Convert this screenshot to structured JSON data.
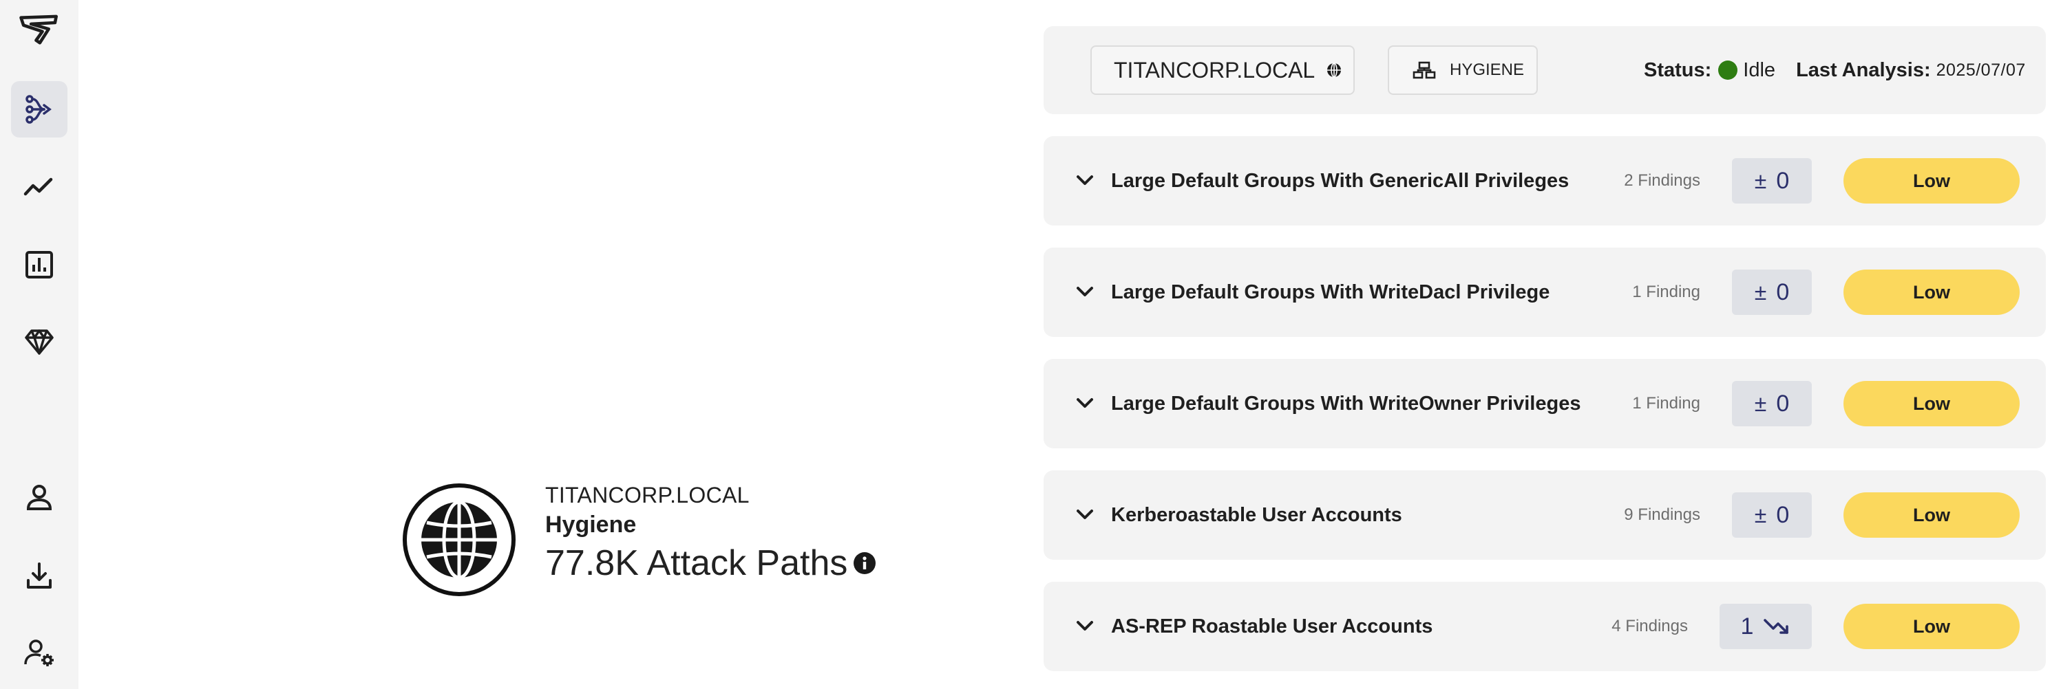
{
  "sidebar": {
    "items": [
      {
        "name": "logo-icon"
      },
      {
        "name": "attack-paths-icon",
        "active": true
      },
      {
        "name": "trend-icon"
      },
      {
        "name": "reports-icon"
      },
      {
        "name": "diamond-icon"
      },
      {
        "name": "user-icon"
      },
      {
        "name": "download-icon"
      },
      {
        "name": "user-settings-icon"
      }
    ]
  },
  "summary": {
    "domain": "TITANCORP.LOCAL",
    "type": "Hygiene",
    "attack_paths": "77.8K Attack Paths"
  },
  "header": {
    "domain_chip": "TITANCORP.LOCAL",
    "env_chip": "HYGIENE",
    "status_label": "Status:",
    "status_value": "Idle",
    "status_color": "#2e7d12",
    "last_analysis_label": "Last Analysis:",
    "last_analysis_value": "2025/07/07"
  },
  "findings": [
    {
      "title": "Large Default Groups With GenericAll Privileges",
      "count": "2 Findings",
      "delta_symbol": "±",
      "delta_value": "0",
      "trend": "none",
      "severity": "Low"
    },
    {
      "title": "Large Default Groups With WriteDacl Privilege",
      "count": "1 Finding",
      "delta_symbol": "±",
      "delta_value": "0",
      "trend": "none",
      "severity": "Low"
    },
    {
      "title": "Large Default Groups With WriteOwner Privileges",
      "count": "1 Finding",
      "delta_symbol": "±",
      "delta_value": "0",
      "trend": "none",
      "severity": "Low"
    },
    {
      "title": "Kerberoastable User Accounts",
      "count": "9 Findings",
      "delta_symbol": "±",
      "delta_value": "0",
      "trend": "none",
      "severity": "Low"
    },
    {
      "title": "AS-REP Roastable User Accounts",
      "count": "4 Findings",
      "delta_symbol": "",
      "delta_value": "1",
      "trend": "down",
      "severity": "Low"
    }
  ],
  "colors": {
    "severity_low": "#fbd85d",
    "accent": "#2b2f6b"
  }
}
